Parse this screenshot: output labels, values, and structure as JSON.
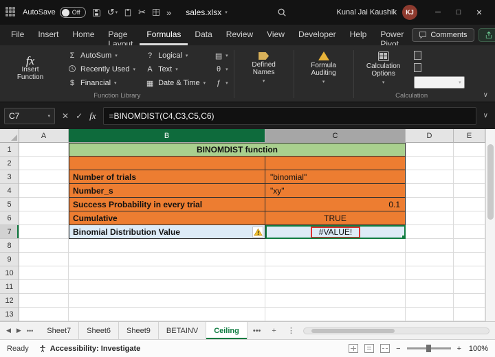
{
  "colors": {
    "accent": "#107C41",
    "orange": "#ED7D31",
    "lightgreen": "#A9D08E",
    "lightblue": "#DDEBF7",
    "red": "#E03131",
    "avatar": "#8E3B2F"
  },
  "icons": {
    "chevron": "▾",
    "collapse": "∨",
    "cancel": "✕",
    "enter": "✓",
    "fx": "fx",
    "undo": "↺",
    "cut": "✂",
    "more_cmds": "»",
    "ellipsis": "•••",
    "prev": "◀",
    "next": "▶",
    "plus": "+",
    "kebab": "⋮",
    "minimize": "─",
    "maximize": "□",
    "close": "✕",
    "sigma": "Σ",
    "question": "?",
    "letter_a": "A",
    "calendar": "▦",
    "lookup": "▤",
    "theta": "θ",
    "fhook": "ƒ",
    "zoom_out": "−",
    "zoom_in": "+"
  },
  "titlebar": {
    "autosave": "AutoSave",
    "autosave_state": "Off",
    "filename": "sales.xlsx",
    "user": "Kunal Jai Kaushik",
    "initials": "KJ"
  },
  "ribbon_tabs": [
    "File",
    "Insert",
    "Home",
    "Page Layout",
    "Formulas",
    "Data",
    "Review",
    "View",
    "Developer",
    "Help",
    "Power Pivot"
  ],
  "comments": "Comments",
  "ribbon": {
    "insert_function": "Insert Function",
    "autosum": "AutoSum",
    "recently_used": "Recently Used",
    "financial": "Financial",
    "logical": "Logical",
    "text": "Text",
    "date_time": "Date & Time",
    "defined_names": "Defined Names",
    "formula_auditing": "Formula Auditing",
    "calculation_options": "Calculation Options",
    "caption_function_library": "Function Library",
    "caption_calculation": "Calculation"
  },
  "formula_bar": {
    "name_box": "C7",
    "formula": "=BINOMDIST(C4,C3,C5,C6)"
  },
  "sheet": {
    "columns": [
      "A",
      "B",
      "C",
      "D",
      "E"
    ],
    "rows": [
      "1",
      "2",
      "3",
      "4",
      "5",
      "6",
      "7",
      "8",
      "9",
      "10",
      "11",
      "12",
      "13"
    ],
    "title_cell": "BINOMDIST function",
    "data": [
      {
        "label": "Number of trials",
        "value": "\"binomial\""
      },
      {
        "label": "Number_s",
        "value": "\"xy\""
      },
      {
        "label": "Success Probability in every trial",
        "value": "0.1"
      },
      {
        "label": "Cumulative",
        "value": "TRUE"
      },
      {
        "label": "Binomial Distribution Value",
        "value": "#VALUE!"
      }
    ]
  },
  "sheet_tabs": [
    "Sheet7",
    "Sheet6",
    "Sheet9",
    "BETAINV",
    "Ceiling"
  ],
  "status": {
    "mode": "Ready",
    "accessibility": "Accessibility: Investigate",
    "zoom": "100%"
  }
}
